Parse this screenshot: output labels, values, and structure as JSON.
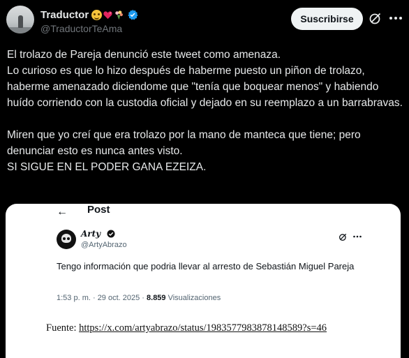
{
  "tweet": {
    "display_name": "Traductor",
    "handle": "@TraductorTeAma",
    "emoji_icons": [
      "pleading-face-icon",
      "heart-icon",
      "bouquet-icon"
    ],
    "verified_icon": "verified-badge-icon",
    "subscribe_label": "Suscribirse",
    "actions": [
      "grok-icon",
      "more-icon"
    ],
    "paragraphs": [
      "El trolazo de Pareja denunció este tweet como amenaza.",
      "Lo curioso es que lo hizo después de haberme puesto un piñon de trolazo, haberme amenazado diciendome que \"tenía que boquear menos\" y habiendo huído corriendo con la custodia oficial y dejado en su reemplazo a un barrabravas.",
      "Miren que yo creí que era trolazo por la mano de manteca que tiene; pero denunciar esto es nunca antes visto.",
      "SI SIGUE EN EL PODER GANA EZEIZA."
    ]
  },
  "embed": {
    "back_icon": "←",
    "title": "Post",
    "author_name": "Arty",
    "author_handle": "@ArtyAbrazo",
    "post_text": "Tengo información que podria llevar al arresto de Sebastián Miguel Pareja",
    "time": "1:53 p. m. · 29 oct. 2025 · ",
    "views_count": "8.859",
    "views_label": " Visualizaciones",
    "source_label": "Fuente: ",
    "source_link": "https://x.com/artyabrazo/status/1983577983878148589?s=46"
  },
  "colors": {
    "background": "#000000",
    "text": "#e7e9ea",
    "secondary": "#71767b",
    "verified": "#1d9bf0",
    "button_bg": "#eff3f4"
  }
}
